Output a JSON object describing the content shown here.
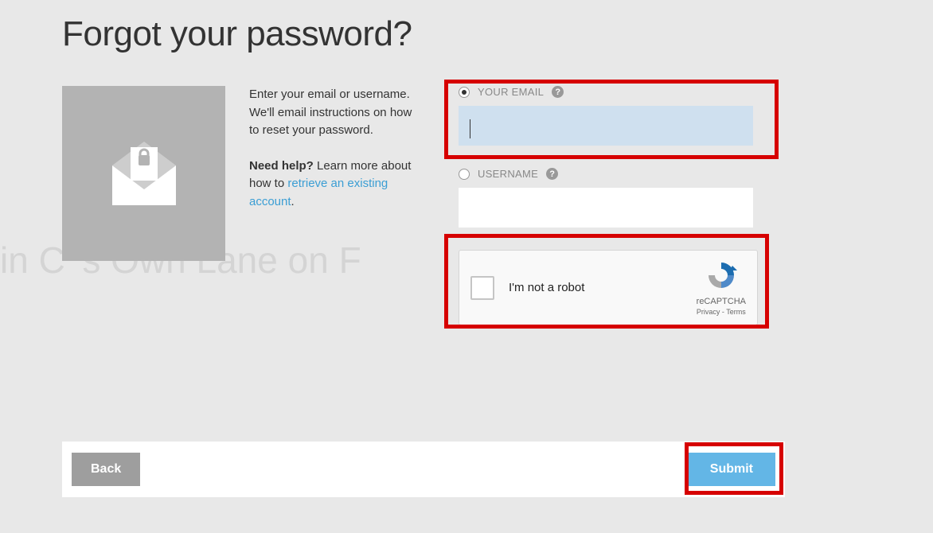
{
  "title": "Forgot your password?",
  "instructions": "Enter your email or username. We'll email instructions on how to reset your password.",
  "help": {
    "prefix": "Need help?",
    "text": " Learn more about how to ",
    "link": "retrieve an existing account",
    "suffix": "."
  },
  "fields": {
    "email": {
      "label": "YOUR EMAIL",
      "value": "",
      "selected": true
    },
    "username": {
      "label": "USERNAME",
      "value": "",
      "selected": false
    }
  },
  "recaptcha": {
    "label": "I'm not a robot",
    "brand": "reCAPTCHA",
    "links": "Privacy - Terms"
  },
  "buttons": {
    "back": "Back",
    "submit": "Submit"
  },
  "help_icon": "?"
}
